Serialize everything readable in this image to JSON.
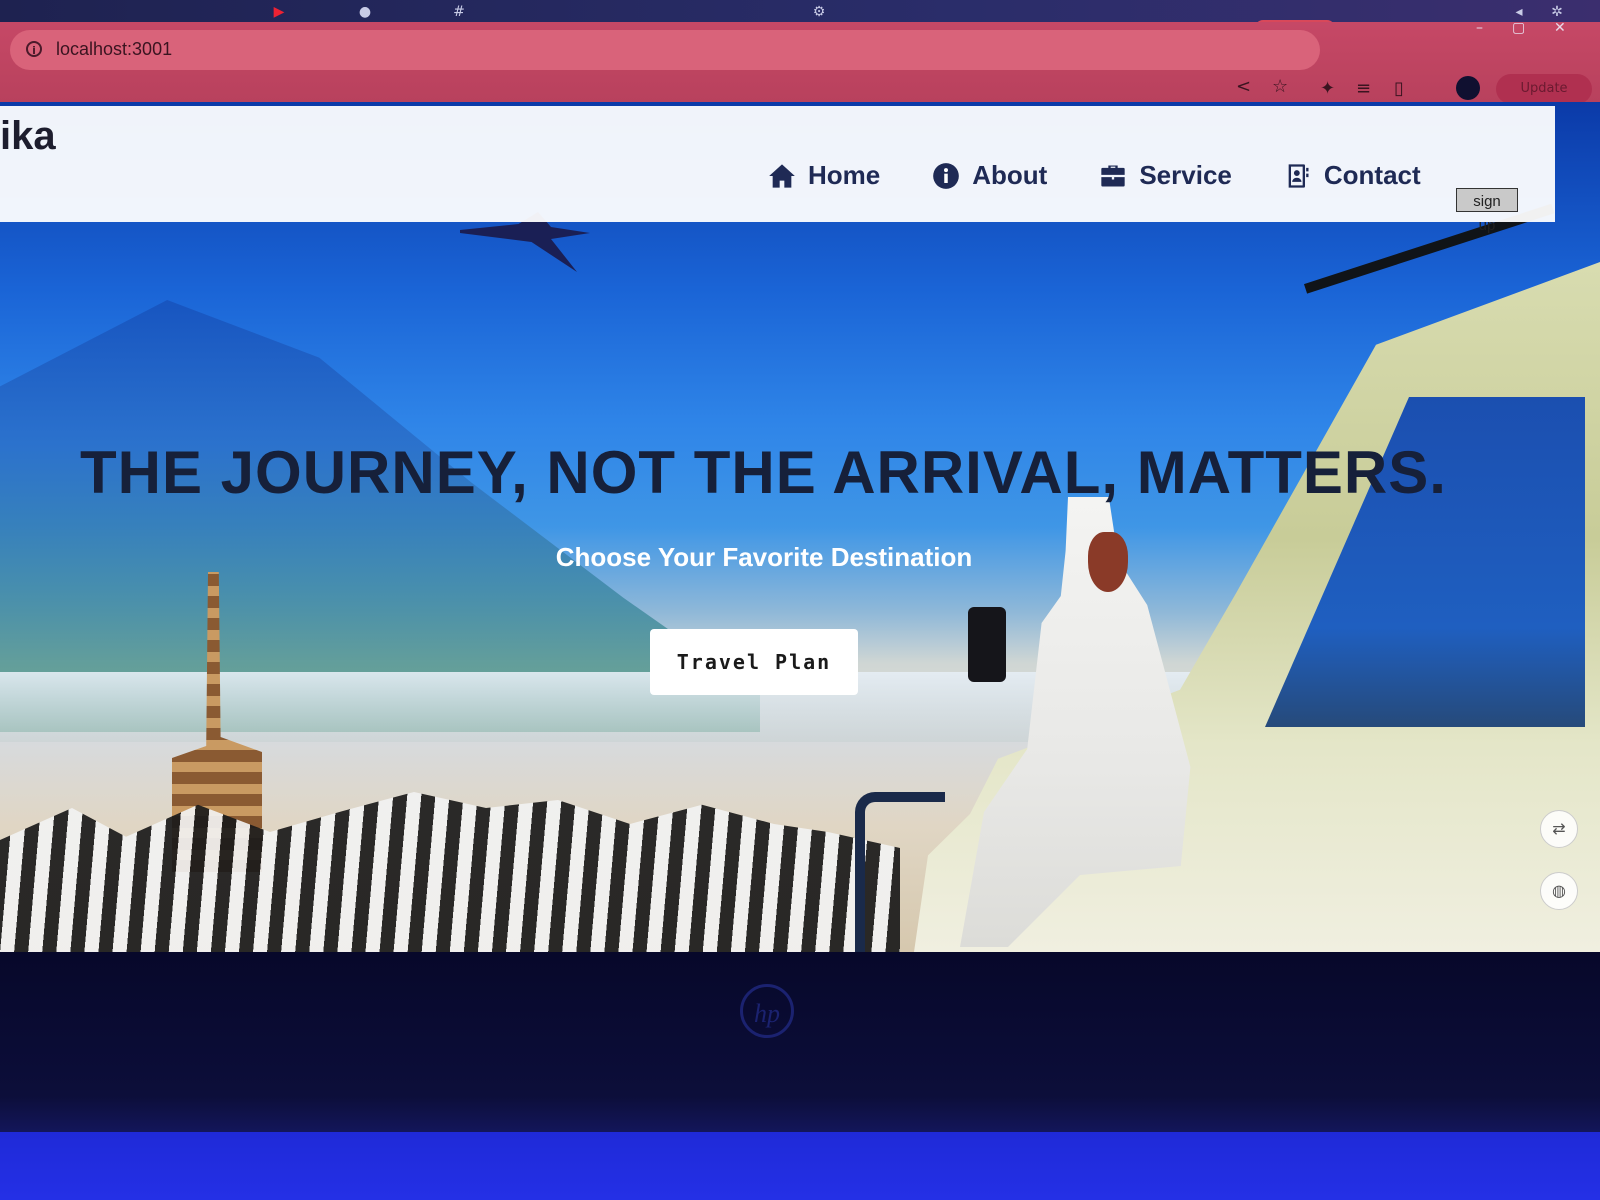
{
  "browser": {
    "url": "localhost:3001",
    "update_label": "Update"
  },
  "site": {
    "logo": "ika",
    "nav": [
      {
        "label": "Home",
        "icon": "home-icon"
      },
      {
        "label": "About",
        "icon": "info-icon"
      },
      {
        "label": "Service",
        "icon": "briefcase-icon"
      },
      {
        "label": "Contact",
        "icon": "contact-card-icon"
      }
    ],
    "signup_label": "sign up"
  },
  "hero": {
    "headline": "THE JOURNEY, NOT THE ARRIVAL, MATTERS.",
    "subheadline": "Choose Your Favorite Destination",
    "cta_label": "Travel Plan"
  },
  "colors": {
    "nav_text": "#1f2a55",
    "headline": "#16203a",
    "browser_toolbar": "#c64866"
  },
  "device": {
    "brand_mark": "hp"
  }
}
